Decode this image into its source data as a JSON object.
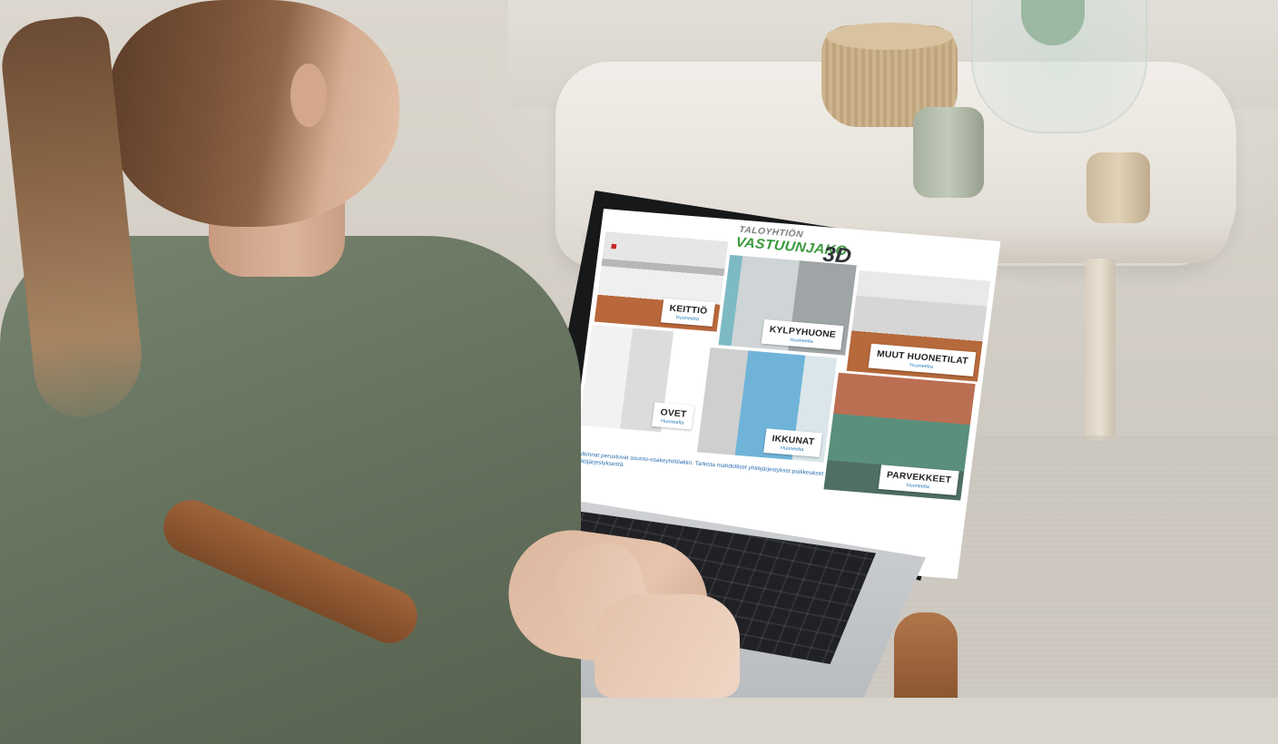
{
  "site": {
    "logo": {
      "top_line": "TALOYHTIÖN",
      "main_line": "VASTUUNJAKO",
      "suffix": "3D"
    },
    "rooms": [
      {
        "title": "KEITTIÖ",
        "subtitle": "Huoneelta"
      },
      {
        "title": "KYLPYHUONE",
        "subtitle": "Huoneelta"
      },
      {
        "title": "MUUT HUONETILAT",
        "subtitle": "Huoneelta"
      },
      {
        "title": "OVET",
        "subtitle": "Huoneelta"
      },
      {
        "title": "IKKUNAT",
        "subtitle": "Huoneelta"
      },
      {
        "title": "PARVEKKEET",
        "subtitle": "Huoneelta"
      }
    ],
    "footer_note": "Tulkinnat perustuvat asunto-osakeyhtiölakiin. Tarkista mahdolliset yhtiöjärjestykset poikkeukset yhtiöjärjestyksestä."
  },
  "colors": {
    "logo_green": "#3a9a3c",
    "link_blue": "#2a7fb8",
    "shirt": "#6b7864"
  }
}
